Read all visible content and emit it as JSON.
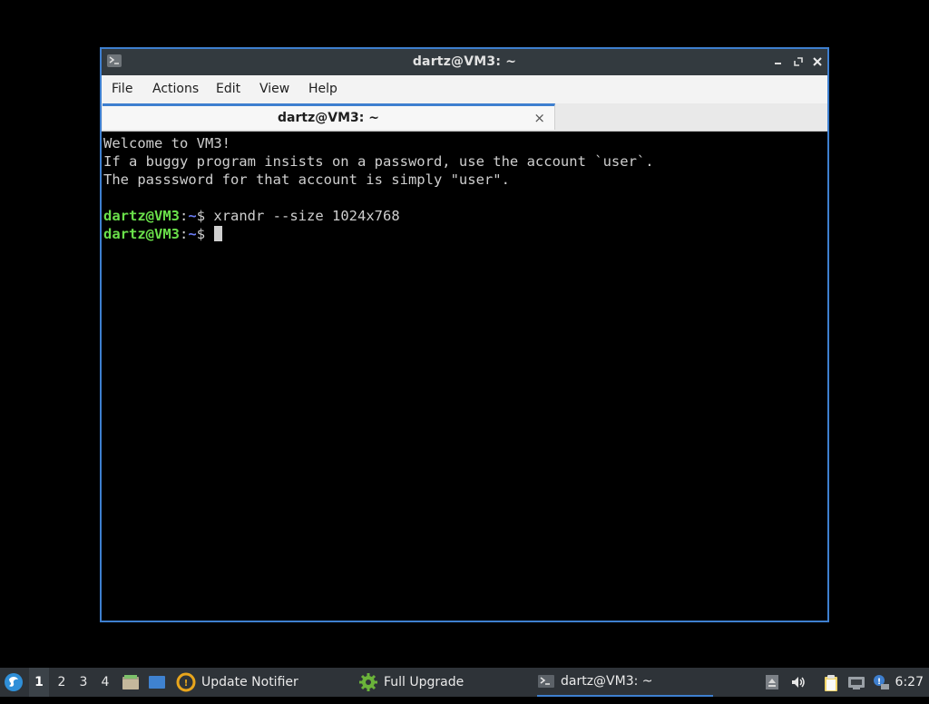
{
  "window": {
    "title": "dartz@VM3: ~",
    "menu": [
      "File",
      "Actions",
      "Edit",
      "View",
      "Help"
    ],
    "tab": {
      "label": "dartz@VM3: ~",
      "close": "×"
    }
  },
  "terminal": {
    "welcome": [
      "Welcome to VM3!",
      "If a buggy program insists on a password, use the account `user`.",
      "The passsword for that account is simply \"user\"."
    ],
    "prompt": {
      "user": "dartz@VM3",
      "sep": ":",
      "path": "~",
      "symbol": "$ "
    },
    "command": "xrandr --size 1024x768"
  },
  "taskbar": {
    "workspaces": [
      "1",
      "2",
      "3",
      "4"
    ],
    "active_workspace": "1",
    "tasks": [
      "Update Notifier",
      "Full Upgrade",
      "dartz@VM3: ~"
    ],
    "clock": "6:27"
  },
  "colors": {
    "accent": "#3e7fcf",
    "prompt_user": "#6ae04a",
    "prompt_path": "#6b7cf5"
  }
}
